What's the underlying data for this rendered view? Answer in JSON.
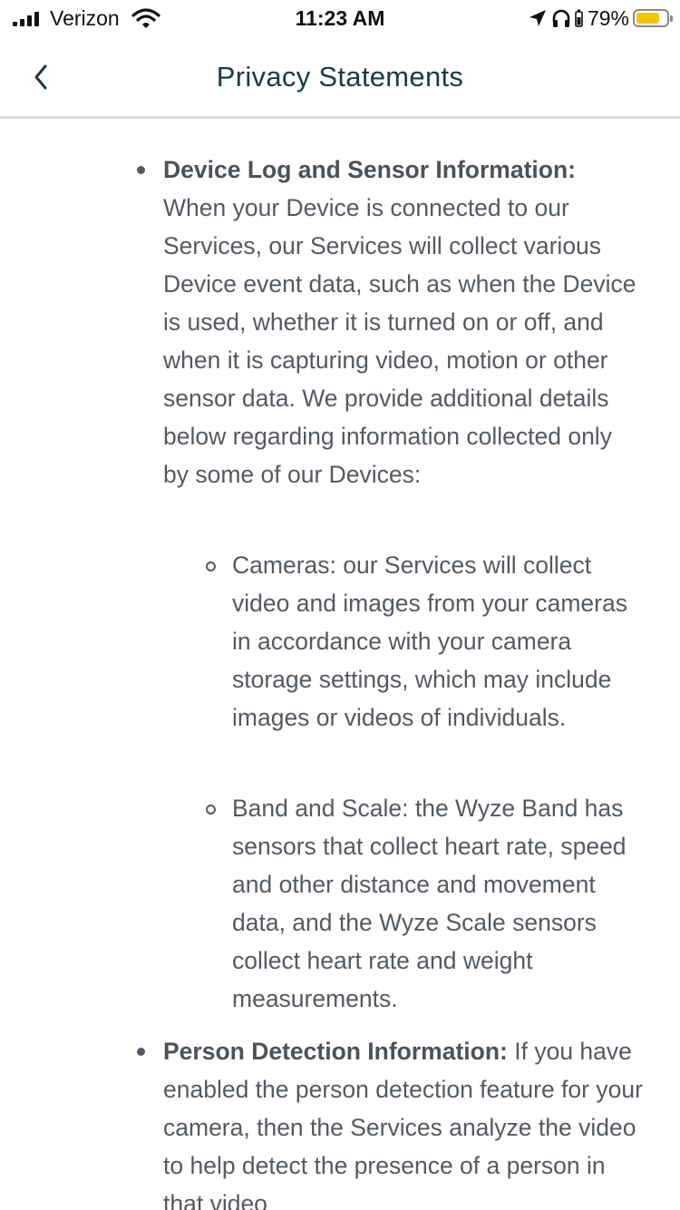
{
  "status_bar": {
    "carrier": "Verizon",
    "time": "11:23 AM",
    "battery_percent": "79%",
    "icons": [
      "signal-bars-icon",
      "wifi-icon",
      "location-arrow-icon",
      "headphones-icon",
      "battery-icon"
    ],
    "battery_level": 0.79,
    "battery_color": "#f5c400"
  },
  "nav": {
    "title": "Privacy Statements",
    "back_icon": "chevron-left-icon"
  },
  "content": {
    "items": [
      {
        "heading": "Device Log and Sensor Information:",
        "body": "When your Device is connected to our Services, our Services will collect various Device event data, such as when the Device is used, whether it is turned on or off, and when it is capturing video, motion or other sensor data. We provide additional details below regarding information collected only by some of our Devices:",
        "subitems": [
          {
            "text": "Cameras: our Services will collect video and images from your cameras in accordance with your camera storage settings, which may include images or videos of individuals."
          },
          {
            "text": "Band and Scale: the Wyze Band has sensors that collect heart rate, speed and other distance and movement data, and the Wyze Scale sensors collect heart rate and weight measurements."
          }
        ]
      },
      {
        "heading": "Person Detection Information:",
        "body": "If you have enabled the person detection feature for your camera, then the Services analyze the video to help detect the presence of a person in that video"
      }
    ]
  },
  "colors": {
    "text": "#555a60",
    "title": "#1d3a44",
    "divider": "#d9dbdd"
  }
}
